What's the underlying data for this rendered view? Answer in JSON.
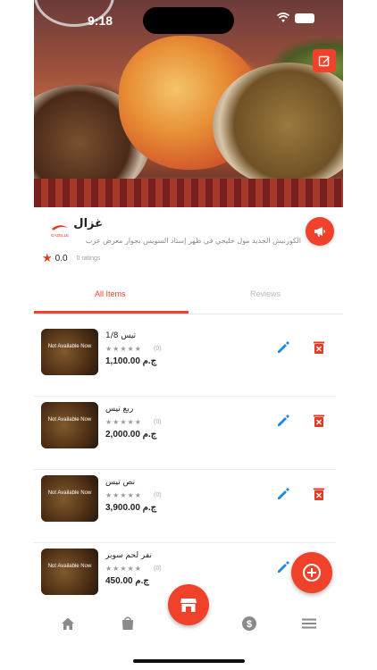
{
  "status_bar": {
    "time": "9:18"
  },
  "restaurant": {
    "name": "غزال",
    "address": "الكورنيش الجديد مول خليجي في ظهر إستاد السويس بجوار معرض عرب",
    "rating_value": "0.0",
    "rating_count": "0 ratings",
    "logo_text": "GAZELLE"
  },
  "tabs": [
    {
      "label": "All Items",
      "active": true
    },
    {
      "label": "Reviews",
      "active": false
    }
  ],
  "items": [
    {
      "name": "تيس 1/8",
      "status": "Not Available Now",
      "stars": "★★★★★",
      "rating_count": "(0)",
      "price": "1,100.00 ج.م"
    },
    {
      "name": "ربع تيس",
      "status": "Not Available Now",
      "stars": "★★★★★",
      "rating_count": "(0)",
      "price": "2,000.00 ج.م"
    },
    {
      "name": "نص تيس",
      "status": "Not Available Now",
      "stars": "★★★★★",
      "rating_count": "(0)",
      "price": "3,900.00 ج.م"
    },
    {
      "name": "نفر لحم سوبر",
      "status": "Not Available Now",
      "stars": "★★★★★",
      "rating_count": "(0)",
      "price": "450.00 ج.م"
    }
  ],
  "icons": {
    "edit_photo": "edit-square-icon",
    "promo": "megaphone-icon",
    "item_edit": "pencil-icon",
    "item_delete": "trash-x-icon",
    "add": "plus-circle-icon",
    "nav": [
      "home-icon",
      "shopping-bag-icon",
      "store-icon",
      "dollar-icon",
      "menu-icon"
    ]
  },
  "colors": {
    "accent": "#f0412b",
    "edit_blue": "#1e88e5",
    "text": "#222222",
    "muted": "#a0a0a0"
  }
}
